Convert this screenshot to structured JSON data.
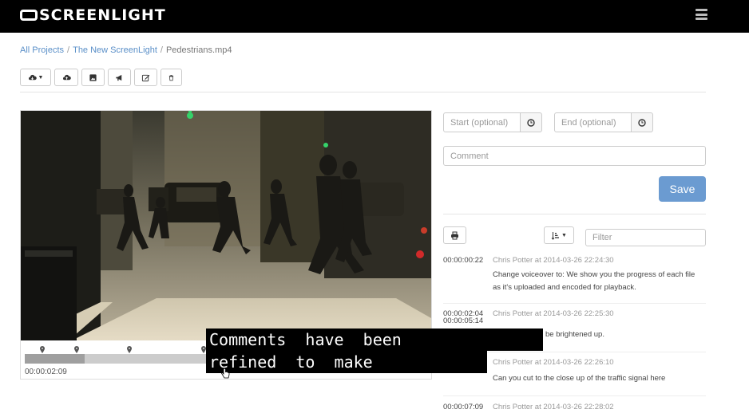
{
  "app": {
    "logo_text": "SCREENLIGHT"
  },
  "breadcrumb": {
    "items": [
      "All Projects",
      "The New ScreenLight"
    ],
    "current": "Pedestrians.mp4",
    "sep": "/"
  },
  "toolbar": {
    "buttons": [
      "cloud-download-icon",
      "cloud-upload-icon",
      "image-icon",
      "megaphone-icon",
      "edit-icon",
      "trash-icon"
    ]
  },
  "video": {
    "timecode": "00:00:02:09",
    "progress_fraction": 0.15
  },
  "form": {
    "start_placeholder": "Start (optional)",
    "end_placeholder": "End (optional)",
    "comment_placeholder": "Comment",
    "save_label": "Save",
    "filter_placeholder": "Filter"
  },
  "comments": [
    {
      "time": "00:00:00:22",
      "time2": "",
      "author": "Chris Potter at 2014-03-26 22:24:30",
      "text": "Change voiceover to: We show you the progress of each file as it's uploaded and encoded for playback."
    },
    {
      "time": "00:00:02:04",
      "time2": "00:00:05:14",
      "author": "Chris Potter at 2014-03-26 22:25:30",
      "text": "range needs to be brightened up."
    },
    {
      "time": "",
      "time2": "",
      "author": "Chris Potter at 2014-03-26 22:26:10",
      "text": "Can you cut to the close up of the traffic signal here"
    },
    {
      "time": "00:00:07:09",
      "time2": "",
      "author": "Chris Potter at 2014-03-26 22:28:02",
      "text": ""
    }
  ],
  "caption": {
    "line1": "Comments  have  been",
    "line2": "refined  to  make"
  },
  "colors": {
    "topbar": "#000000",
    "accent": "#6b9bd1",
    "link": "#5a8fc8"
  }
}
